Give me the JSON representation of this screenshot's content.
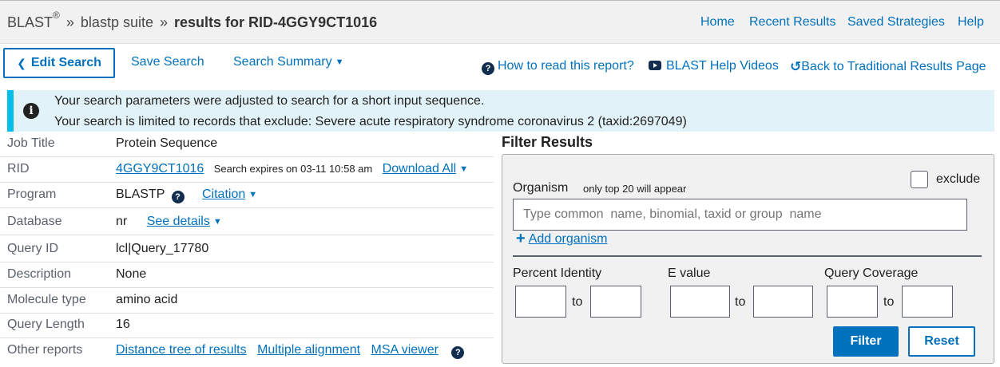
{
  "header": {
    "blast": "BLAST",
    "reg": "®",
    "sep1": "»",
    "suite": "blastp suite",
    "sep2": "»",
    "results": "results for RID-4GGY9CT1016",
    "nav": [
      "Home",
      "Recent Results",
      "Saved Strategies",
      "Help"
    ]
  },
  "toolbar": {
    "edit_search": "Edit Search",
    "save_search": "Save Search",
    "search_summary": "Search Summary",
    "how_to_read": "How to read this report?",
    "help_videos": "BLAST Help Videos",
    "back_traditional": "Back to Traditional Results Page"
  },
  "banner": {
    "line1": "Your search parameters were adjusted to search for a short input sequence.",
    "line2": "Your search is limited to records that exclude: Severe acute respiratory syndrome coronavirus 2 (taxid:2697049)"
  },
  "details": {
    "job_title": {
      "label": "Job Title",
      "value": "Protein Sequence"
    },
    "rid": {
      "label": "RID",
      "value": "4GGY9CT1016",
      "expires": "Search expires on 03-11 10:58 am",
      "download": "Download All"
    },
    "program": {
      "label": "Program",
      "value": "BLASTP",
      "citation": "Citation"
    },
    "database": {
      "label": "Database",
      "value": "nr",
      "see_details": "See details"
    },
    "query_id": {
      "label": "Query ID",
      "value": "lcl|Query_17780"
    },
    "description": {
      "label": "Description",
      "value": "None"
    },
    "molecule_type": {
      "label": "Molecule type",
      "value": "amino acid"
    },
    "query_length": {
      "label": "Query Length",
      "value": "16"
    },
    "other_reports": {
      "label": "Other reports",
      "distance_tree": "Distance tree of results",
      "multiple_alignment": "Multiple alignment",
      "msa_viewer": "MSA viewer"
    }
  },
  "filter": {
    "title": "Filter Results",
    "organism_label": "Organism",
    "organism_note": "only top 20 will appear",
    "exclude_label": "exclude",
    "organism_placeholder": "Type common  name, binomial, taxid or group  name",
    "add_organism": "Add organism",
    "percent_identity": "Percent Identity",
    "e_value": "E value",
    "query_coverage": "Query Coverage",
    "to": "to",
    "filter_button": "Filter",
    "reset_button": "Reset"
  },
  "colors": {
    "link": "#0071bc",
    "banner_bg": "#e1f3f8",
    "banner_accent": "#02bfe7",
    "panel_bg": "#f1f1f1"
  }
}
